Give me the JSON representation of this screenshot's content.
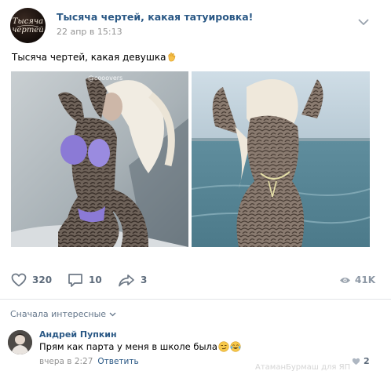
{
  "post": {
    "group_logo_lines": [
      "Тысяча",
      "чертей"
    ],
    "group_name": "Тысяча чертей, какая татуировка!",
    "time": "22 апр в 15:13",
    "text": "Тысяча чертей, какая девушка",
    "photos": [
      {
        "watermark": "@cooovers"
      },
      {
        "watermark": ""
      }
    ]
  },
  "actions": {
    "likes": "320",
    "comments": "10",
    "shares": "3",
    "views": "41K"
  },
  "comments_section": {
    "sort_label": "Сначала интересные",
    "items": [
      {
        "author": "Андрей Пупкин",
        "text": "Прям как парта у меня в школе была",
        "time": "вчера в 2:27",
        "reply_label": "Ответить",
        "likes": "2"
      }
    ]
  },
  "watermark": "АтаманБурмаш для ЯП",
  "colors": {
    "link_blue": "#2a5885",
    "icon_gray": "#6d7885",
    "meta_gray": "#939393",
    "divider": "#e2e4e7"
  }
}
